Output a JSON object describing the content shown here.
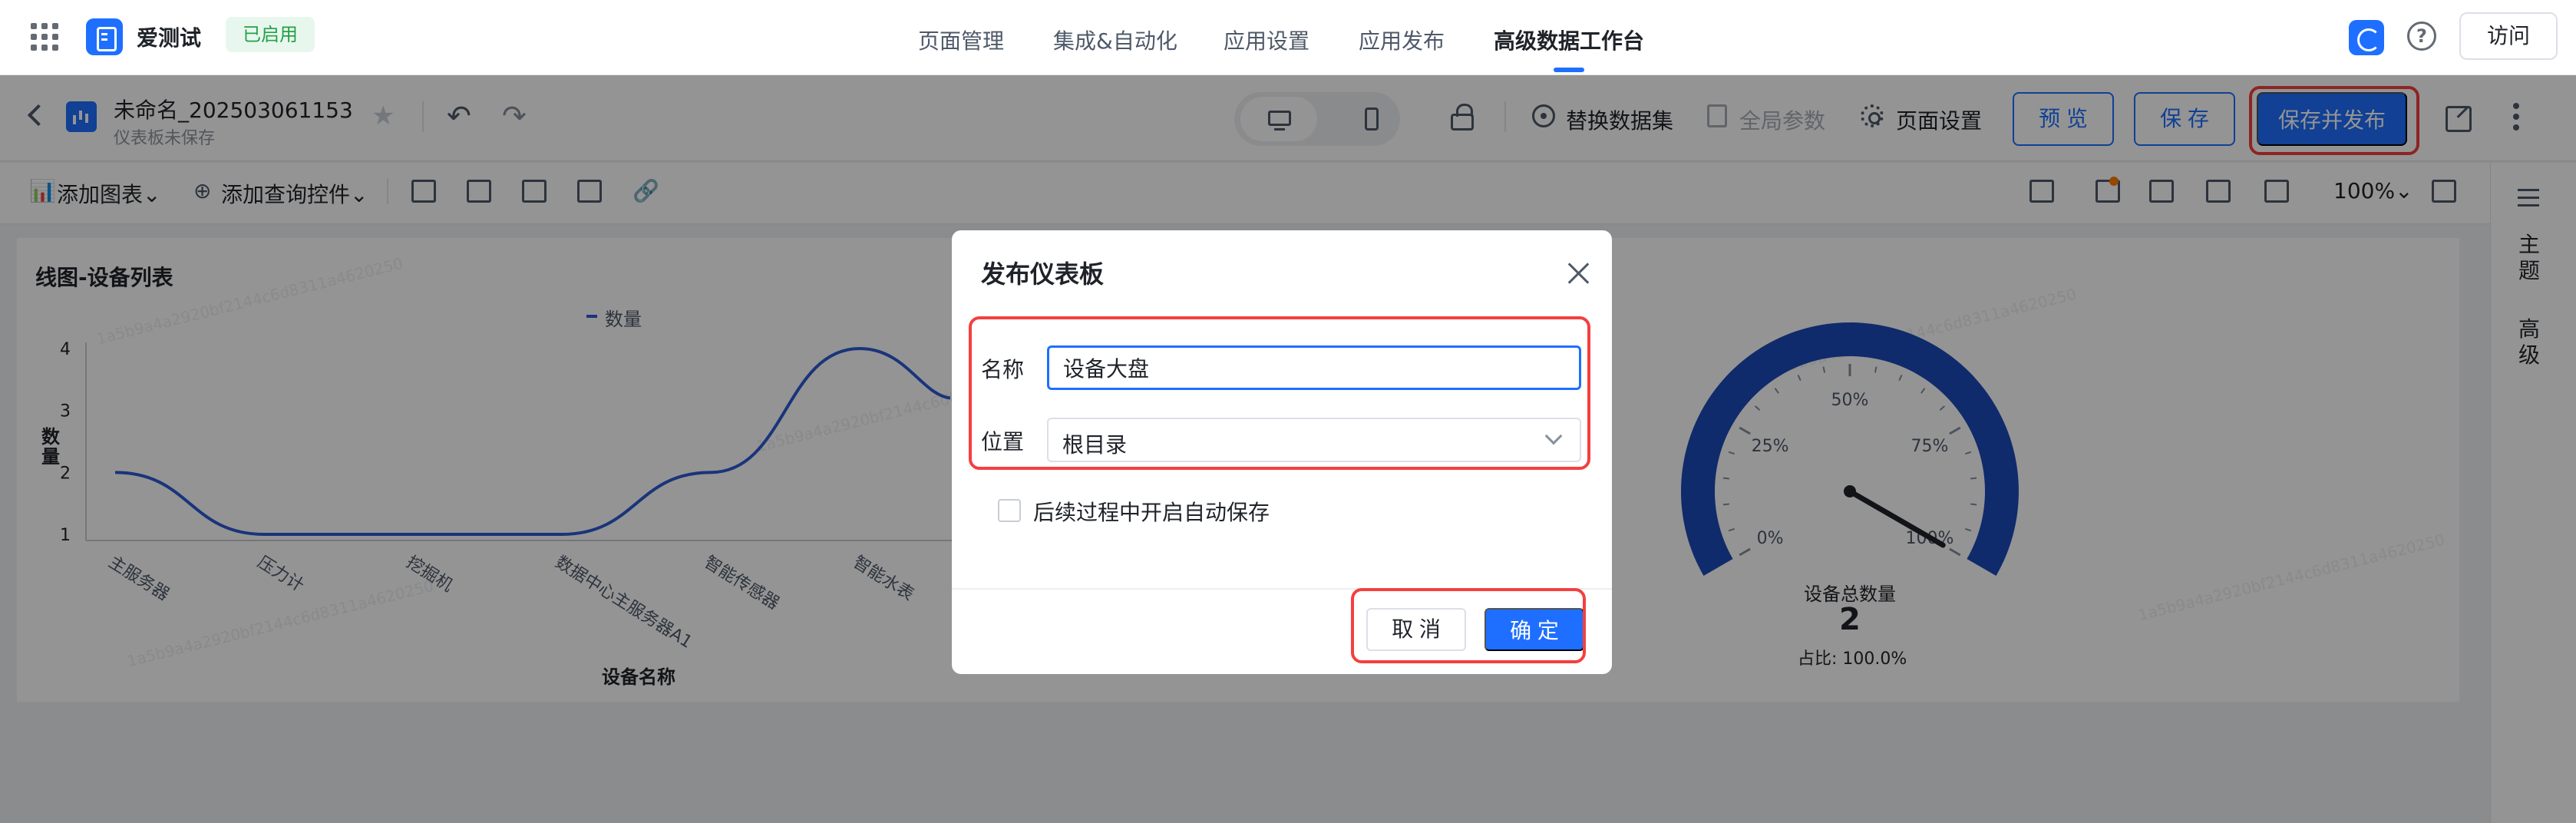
{
  "colors": {
    "brand": "#1e6fff",
    "series_line": "#2d5bd5",
    "gauge_arc": "#1d4bb8",
    "highlight_red": "#f53f3f",
    "enabled_green": "#24a148"
  },
  "app": {
    "name": "爱测试",
    "status": "已启用"
  },
  "nav": {
    "tabs": [
      "页面管理",
      "集成&自动化",
      "应用设置",
      "应用发布",
      "高级数据工作台"
    ],
    "active_index": 4,
    "visit_label": "访问"
  },
  "toolbar": {
    "dashboard_title": "未命名_202503061153",
    "dashboard_subtitle": "仪表板未保存",
    "replace_dataset": "替换数据集",
    "global_params": "全局参数",
    "page_settings": "页面设置",
    "preview": "预 览",
    "save": "保 存",
    "save_publish": "保存并发布"
  },
  "subbar": {
    "add_chart": "添加图表",
    "add_query": "添加查询控件",
    "zoom": "100%"
  },
  "rightbar": {
    "theme": "主题",
    "advanced": "高级"
  },
  "watermark": "1a5b9a4a2920bf2144c6d8311a4620250",
  "chart_data": [
    {
      "type": "line",
      "title": "线图-设备列表",
      "xlabel": "设备名称",
      "ylabel": "数量",
      "categories": [
        "主服务器",
        "压力计",
        "挖掘机",
        "数据中心主服务器A1",
        "智能传感器",
        "智能水表"
      ],
      "series": [
        {
          "name": "数量",
          "values": [
            2,
            1,
            1,
            1,
            2,
            4
          ]
        }
      ],
      "ylim": [
        1,
        4
      ],
      "yticks": [
        1,
        2,
        3,
        4
      ],
      "legend": "top-center",
      "grid": false
    },
    {
      "type": "gauge",
      "title": "设备总数量",
      "value": 2,
      "ratio_text": "占比: 100.0%",
      "percent": 100,
      "tick_labels": [
        "0%",
        "25%",
        "50%",
        "75%",
        "100%"
      ]
    }
  ],
  "modal": {
    "title": "发布仪表板",
    "name_label": "名称",
    "name_value": "设备大盘",
    "location_label": "位置",
    "location_value": "根目录",
    "autosave_label": "后续过程中开启自动保存",
    "cancel": "取 消",
    "confirm": "确 定"
  }
}
